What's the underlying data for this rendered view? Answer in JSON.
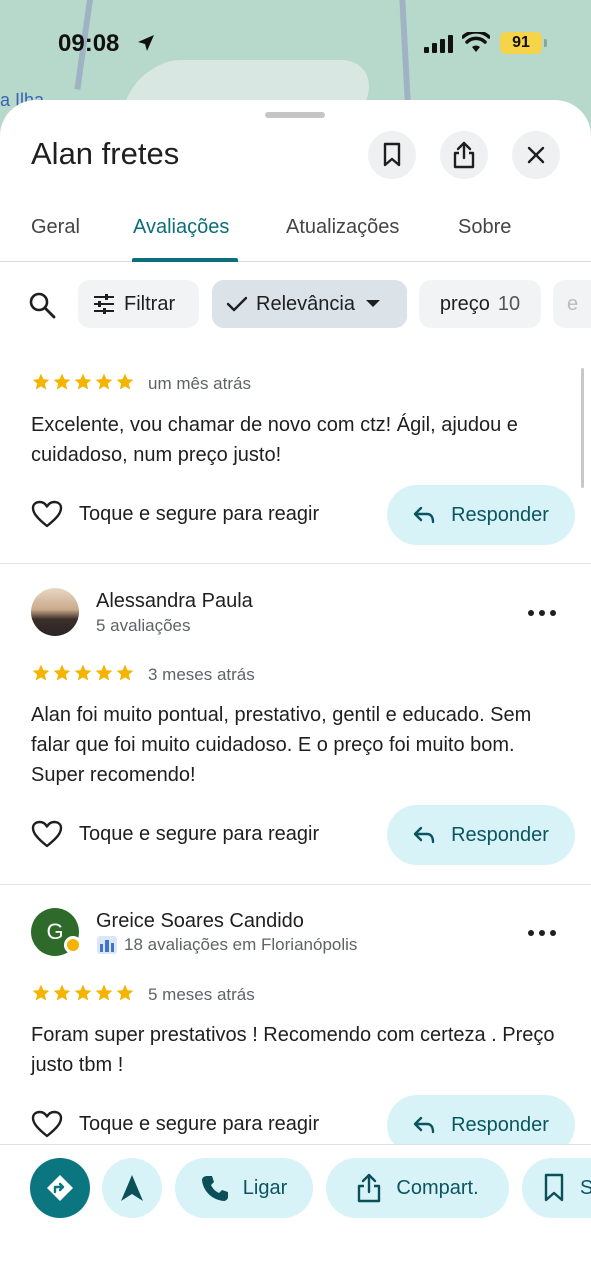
{
  "status_bar": {
    "time": "09:08",
    "battery": "91"
  },
  "map": {
    "label": "a Ilha"
  },
  "header": {
    "title": "Alan fretes"
  },
  "tabs": [
    {
      "label": "Geral"
    },
    {
      "label": "Avaliações"
    },
    {
      "label": "Atualizações"
    },
    {
      "label": "Sobre"
    }
  ],
  "filters": {
    "filter_label": "Filtrar",
    "sort_label": "Relevância",
    "topic_label": "preço",
    "topic_count": "10",
    "next_chip_partial": "e"
  },
  "reviews": [
    {
      "author": "",
      "meta": "",
      "rating": 5,
      "when": "um mês atrás",
      "text": "Excelente, vou chamar de novo com ctz! Ágil, ajudou e cuidadoso, num preço justo!",
      "react_label": "Toque e segure para reagir",
      "reply_label": "Responder"
    },
    {
      "author": "Alessandra Paula",
      "meta": "5 avaliações",
      "rating": 5,
      "when": "3 meses atrás",
      "text": "Alan foi muito pontual, prestativo, gentil e educado. Sem falar que foi muito cuidadoso.  E o preço foi muito bom. Super recomendo!",
      "react_label": "Toque e segure para reagir",
      "reply_label": "Responder"
    },
    {
      "author": "Greice Soares Candido",
      "avatar_letter": "G",
      "meta": "18 avaliações em Florianópolis",
      "rating": 5,
      "when": "5 meses atrás",
      "text": "Foram super prestativos  ! Recomendo com certeza . Preço justo tbm !",
      "react_label": "Toque e segure para reagir",
      "reply_label": "Responder"
    }
  ],
  "bottom_actions": {
    "call_label": "Ligar",
    "share_label": "Compart.",
    "save_partial": "S"
  },
  "colors": {
    "accent": "#0b6e78",
    "star": "#f4b400",
    "reply_bg": "#d7f3f8"
  }
}
